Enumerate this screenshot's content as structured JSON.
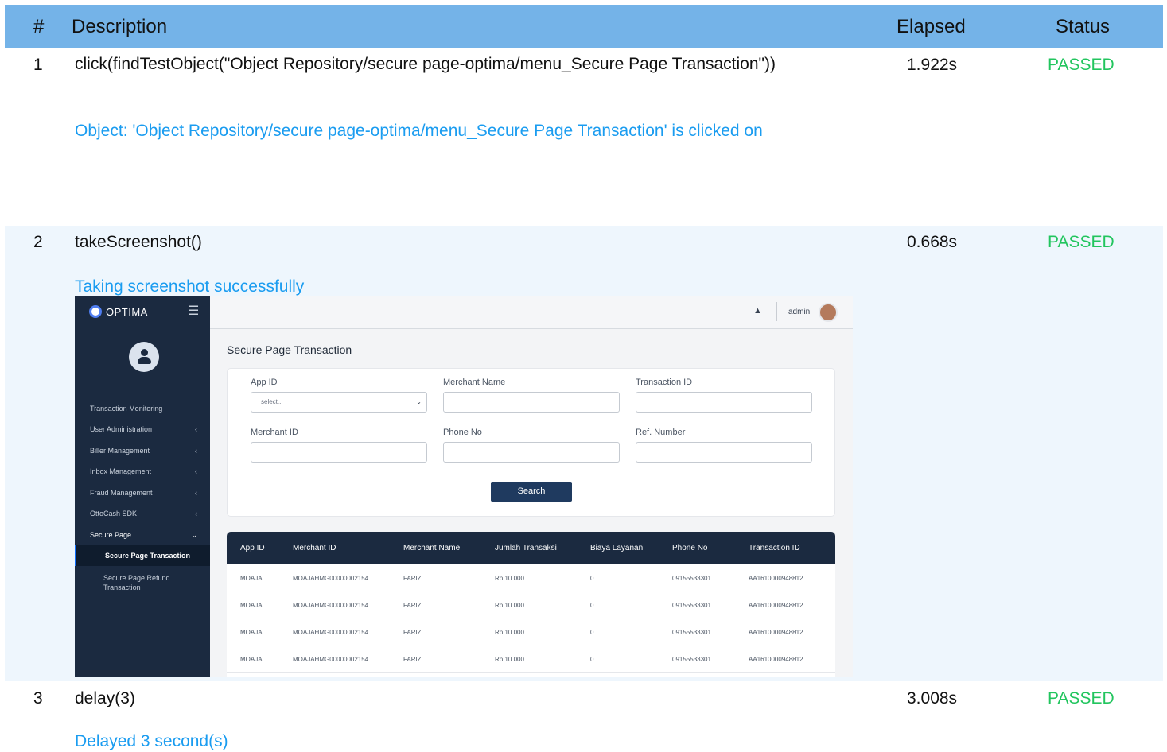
{
  "header": {
    "num": "#",
    "description": "Description",
    "elapsed": "Elapsed",
    "status": "Status"
  },
  "rows": [
    {
      "num": "1",
      "description": "click(findTestObject(\"Object Repository/secure page-optima/menu_Secure Page Transaction\"))",
      "elapsed": "1.922s",
      "status": "PASSED",
      "log": "Object: 'Object Repository/secure page-optima/menu_Secure Page Transaction' is clicked on"
    },
    {
      "num": "2",
      "description": "takeScreenshot()",
      "elapsed": "0.668s",
      "status": "PASSED",
      "log": "Taking screenshot successfully"
    },
    {
      "num": "3",
      "description": "delay(3)",
      "elapsed": "3.008s",
      "status": "PASSED",
      "log": "Delayed 3 second(s)"
    }
  ],
  "screenshot": {
    "logo": "OPTIMA",
    "menu": [
      "Transaction Monitoring",
      "User Administration",
      "Biller Management",
      "Inbox Management",
      "Fraud Management",
      "OttoCash SDK",
      "Secure Page"
    ],
    "submenu": [
      "Secure Page Transaction",
      "Secure Page Refund Transaction"
    ],
    "user": "admin",
    "page_title": "Secure Page Transaction",
    "filters": {
      "app_id_label": "App ID",
      "app_id_value": "select...",
      "merchant_name_label": "Merchant Name",
      "transaction_id_label": "Transaction ID",
      "merchant_id_label": "Merchant ID",
      "phone_no_label": "Phone No",
      "ref_number_label": "Ref. Number",
      "search_button": "Search"
    },
    "table": {
      "columns": [
        "App ID",
        "Merchant ID",
        "Merchant Name",
        "Jumlah Transaksi",
        "Biaya Layanan",
        "Phone No",
        "Transaction ID"
      ],
      "rows": [
        [
          "MOAJA",
          "MOAJAHMG00000002154",
          "FARIZ",
          "Rp 10.000",
          "0",
          "09155533301",
          "AA1610000948812"
        ],
        [
          "MOAJA",
          "MOAJAHMG00000002154",
          "FARIZ",
          "Rp 10.000",
          "0",
          "09155533301",
          "AA1610000948812"
        ],
        [
          "MOAJA",
          "MOAJAHMG00000002154",
          "FARIZ",
          "Rp 10.000",
          "0",
          "09155533301",
          "AA1610000948812"
        ],
        [
          "MOAJA",
          "MOAJAHMG00000002154",
          "FARIZ",
          "Rp 10.000",
          "0",
          "09155533301",
          "AA1610000948812"
        ]
      ]
    }
  }
}
